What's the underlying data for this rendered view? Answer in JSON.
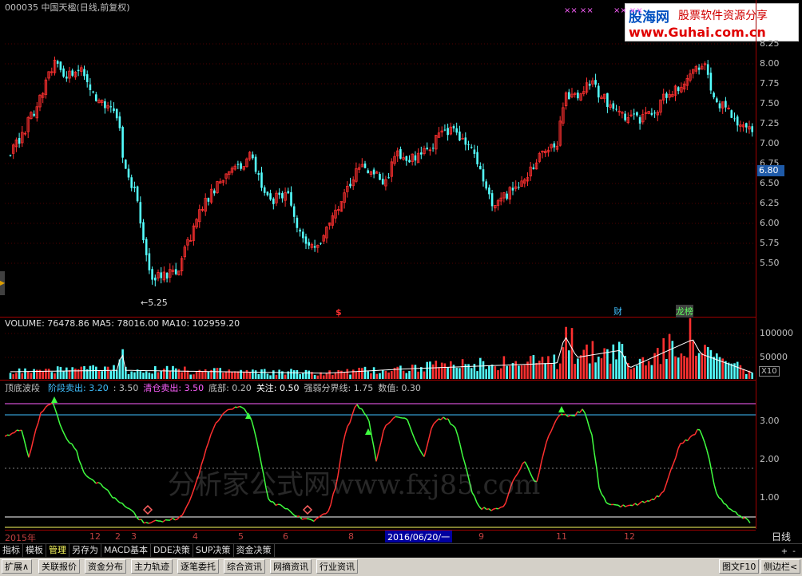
{
  "header": {
    "title": "000035 中国天楹(日线,前复权)"
  },
  "price_axis": [
    "8.25",
    "8.00",
    "7.75",
    "7.50",
    "7.25",
    "7.00",
    "6.75",
    "6.50",
    "6.25",
    "6.00",
    "5.75",
    "5.50"
  ],
  "current_price": "6.80",
  "low_marker": "←5.25",
  "volume": {
    "header": "VOLUME: 76478.86  MA5: 78016.00  MA10: 102959.20",
    "axis": [
      "100000",
      "50000"
    ],
    "scale": "X10"
  },
  "indicator": {
    "name": "顶底波段",
    "items": [
      {
        "label": "阶段卖出: 3.20",
        "color": "#40c0ff"
      },
      {
        "label": ": 3.50",
        "color": "#c0c0c0"
      },
      {
        "label": "清仓卖出: 3.50",
        "color": "#ff60ff"
      },
      {
        "label": "底部: 0.20",
        "color": "#c0c0c0"
      },
      {
        "label": "关注: 0.50",
        "color": "#ffffff"
      },
      {
        "label": "强弱分界线: 1.75",
        "color": "#c0c0c0"
      },
      {
        "label": "数值: 0.30",
        "color": "#c0c0c0"
      }
    ],
    "axis": [
      "3.00",
      "2.00",
      "1.00"
    ]
  },
  "markers": {
    "cai": "财",
    "ranking": "龙榜",
    "dollar": "$",
    "crosses1": "×× ××",
    "crosses2": "×× ××"
  },
  "date_axis": {
    "labels": [
      "2015年",
      "12",
      "2",
      "3",
      "4",
      "5",
      "6",
      "8",
      "9",
      "11",
      "12"
    ],
    "cursor": "2016/06/20/一",
    "period": "日线"
  },
  "logo": {
    "brand": "股海网",
    "slogan": "股票软件资源分享",
    "url": "www.Guhai.com.cn"
  },
  "watermark": "分析家公式网www.fxj85.com",
  "toolbar1": {
    "items": [
      "指标",
      "模板",
      "管理",
      "另存为",
      "MACD基本",
      "DDE决策",
      "SUP决策",
      "资金决策"
    ],
    "active": "管理",
    "right_buttons": [
      "+",
      "-"
    ]
  },
  "toolbar2": {
    "items": [
      "扩展∧",
      "关联报价",
      "资金分布",
      "主力轨迹",
      "逐笔委托",
      "综合资讯",
      "网摘资讯",
      "行业资讯"
    ],
    "right": [
      "图文F10",
      "侧边栏<"
    ]
  },
  "colors": {
    "up": "#ff3030",
    "down": "#54ffff",
    "grid": "#a00000",
    "ind_red": "#ff3030",
    "ind_green": "#40ff40"
  }
}
